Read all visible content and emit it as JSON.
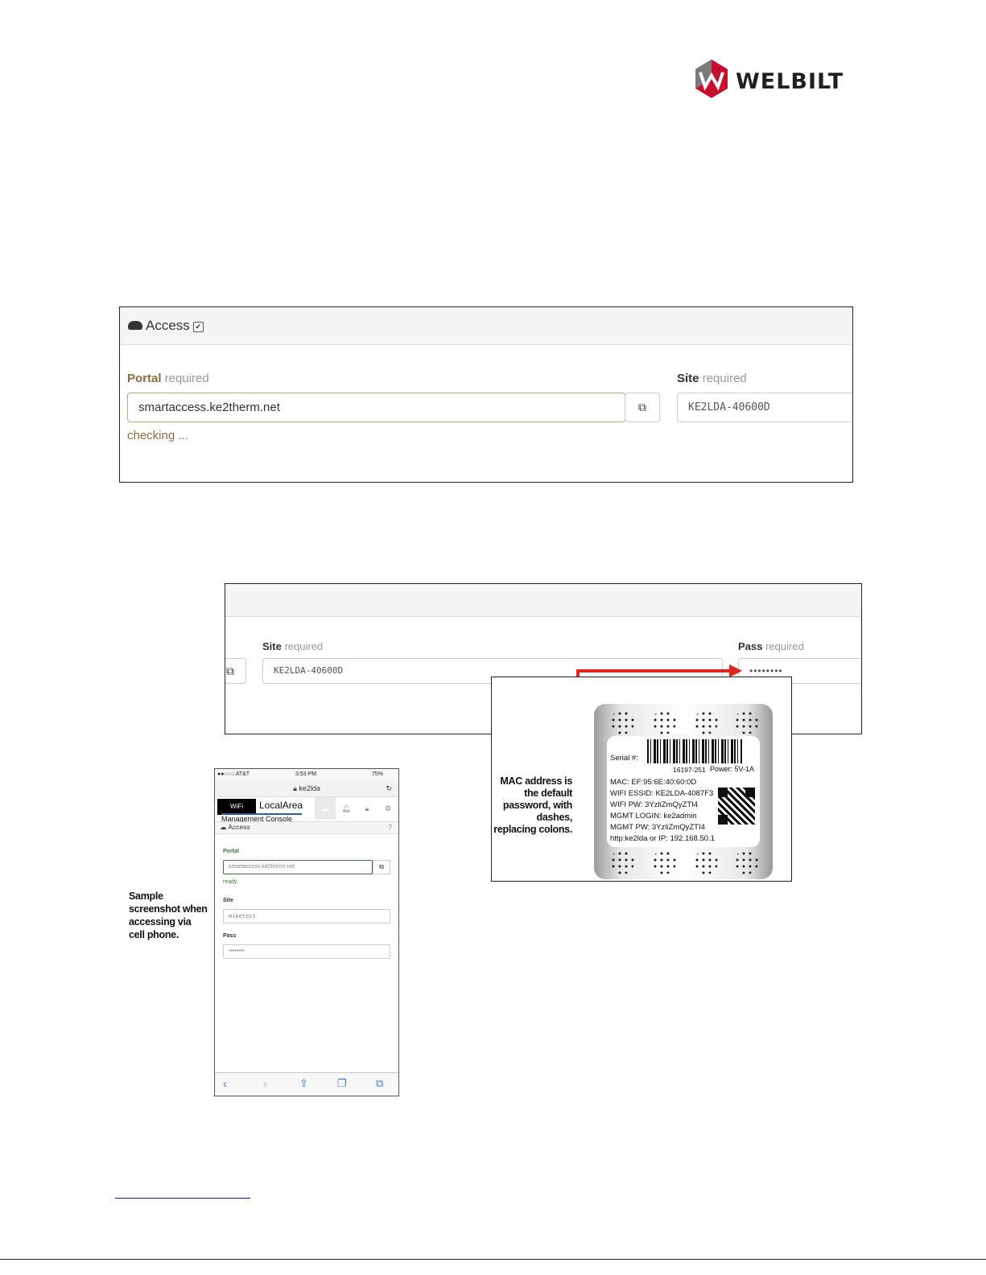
{
  "brand": {
    "name": "WELBILT",
    "colors": {
      "red": "#c8102e",
      "dark": "#231f20"
    }
  },
  "access_panel": {
    "title": "Access",
    "portal": {
      "label": "Portal",
      "hint": "required",
      "value": "smartaccess.ke2therm.net",
      "status": "checking ..."
    },
    "site": {
      "label": "Site",
      "hint": "required",
      "value": "KE2LDA-40600D"
    },
    "external_link_icon": "external-link-icon"
  },
  "access_panel_2": {
    "site": {
      "label": "Site",
      "hint": "required",
      "value": "KE2LDA-40600D"
    },
    "pass": {
      "label": "Pass",
      "hint": "required",
      "value": "••••••••"
    }
  },
  "device_label": {
    "note": "MAC address is the default password, with dashes, replacing colons.",
    "serial_label": "Serial #:",
    "serial_number": "16197-251",
    "power": "Power: 5V-1A",
    "mac": "MAC: EF:95:6E:40:60:0D",
    "wifi_essid": "WIFI ESSID: KE2LDA-4087F3",
    "wifi_pw": "WIFI PW: 3YzliZmQyZTI4",
    "mgmt_login": "MGMT LOGIN: ke2admin",
    "mgmt_pw": "MGMT PW: 3YzliZmQyZTI4",
    "http": "http:ke2lda or IP: 192.168.50.1"
  },
  "phone": {
    "carrier": "●●○○○ AT&T",
    "time": "3:53 PM",
    "battery": "75%",
    "url": "ke2lda",
    "brand": "LocalArea",
    "subtitle": "Management Console",
    "logo_text": "WiFi",
    "access_title": "Access",
    "portal_label": "Portal",
    "portal_value": "smartaccess.ke2therm.net",
    "portal_status": "ready",
    "site_label": "Site",
    "site_value": "miketest",
    "pass_label": "Pass",
    "pass_value": "••••••••",
    "help": "?"
  },
  "sample_note": "Sample screenshot when accessing via cell phone."
}
